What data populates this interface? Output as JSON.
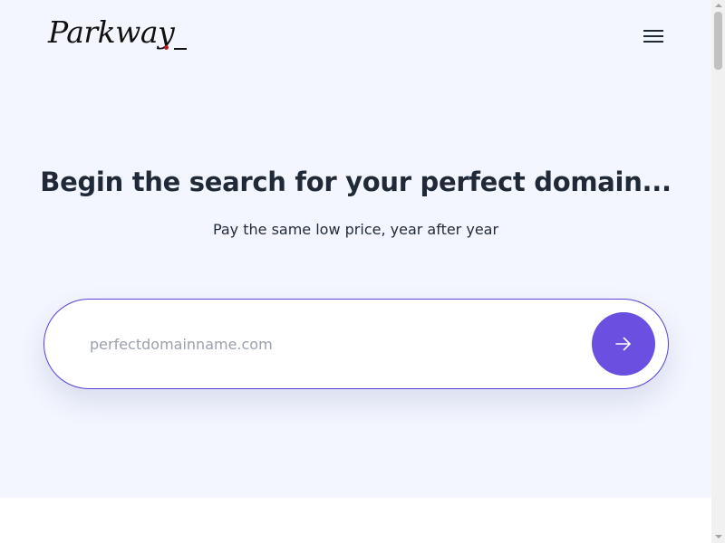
{
  "header": {
    "logo_text": "Parkway",
    "menu_icon": "hamburger-menu-icon"
  },
  "hero": {
    "headline": "Begin the search for your perfect domain...",
    "subheadline": "Pay the same low price, year after year"
  },
  "search": {
    "placeholder": "perfectdomainname.com",
    "value": "",
    "submit_icon": "arrow-right-icon"
  },
  "colors": {
    "hero_background": "#f3f6fe",
    "accent": "#6a4fe0",
    "search_border": "#5b3fd9",
    "logo_dot": "#b11c1c",
    "text": "#1f2937",
    "placeholder": "#9aa1ae"
  }
}
